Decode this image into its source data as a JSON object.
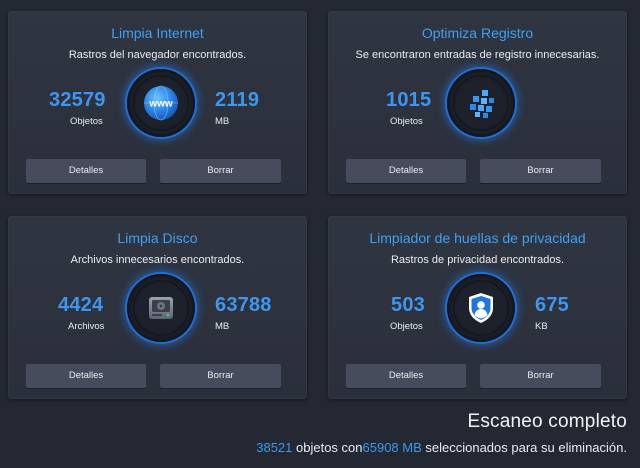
{
  "cards": [
    {
      "title": "Limpia Internet",
      "subtitle": "Rastros del navegador encontrados.",
      "stat1": {
        "value": "32579",
        "unit": "Objetos"
      },
      "stat2": {
        "value": "2119",
        "unit": "MB"
      },
      "icon": "globe-www-icon",
      "details": "Detalles",
      "delete": "Borrar"
    },
    {
      "title": "Optimiza Registro",
      "subtitle": "Se encontraron entradas de registro innecesarias.",
      "stat1": {
        "value": "1015",
        "unit": "Objetos"
      },
      "icon": "registry-cubes-icon",
      "details": "Detalles",
      "delete": "Borrar"
    },
    {
      "title": "Limpia Disco",
      "subtitle": "Archivos innecesarios encontrados.",
      "stat1": {
        "value": "4424",
        "unit": "Archivos"
      },
      "stat2": {
        "value": "63788",
        "unit": "MB"
      },
      "icon": "hard-disk-icon",
      "details": "Detalles",
      "delete": "Borrar"
    },
    {
      "title": "Limpiador de huellas de privacidad",
      "subtitle": "Rastros de privacidad encontrados.",
      "stat1": {
        "value": "503",
        "unit": "Objetos"
      },
      "stat2": {
        "value": "675",
        "unit": "KB"
      },
      "icon": "privacy-shield-user-icon",
      "details": "Detalles",
      "delete": "Borrar"
    }
  ],
  "footer": {
    "title": "Escaneo completo",
    "count": "38521",
    "text1": " objetos con",
    "size": "65908 MB",
    "text2": " seleccionados para su eliminación."
  },
  "colors": {
    "accent": "#3f96ee",
    "title_blue": "#3fa0f4",
    "card_bg": "#2f3541",
    "page_bg": "#232833",
    "button_bg": "#464c5b"
  }
}
